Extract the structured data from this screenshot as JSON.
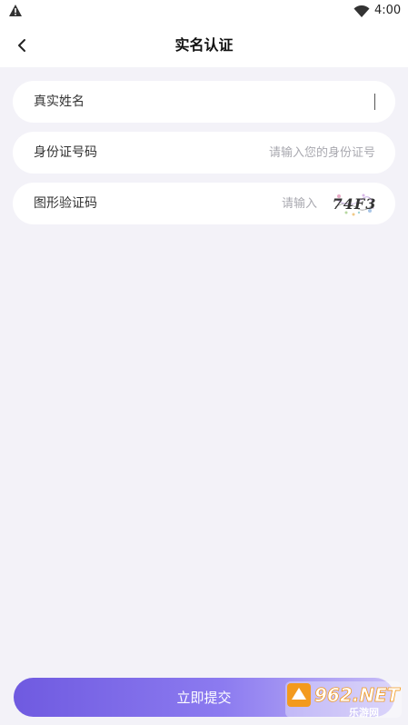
{
  "status": {
    "time": "4:00"
  },
  "header": {
    "title": "实名认证"
  },
  "form": {
    "name": {
      "label": "真实姓名",
      "value": "",
      "placeholder": ""
    },
    "id_number": {
      "label": "身份证号码",
      "value": "",
      "placeholder": "请输入您的身份证号"
    },
    "captcha": {
      "label": "图形验证码",
      "value": "",
      "placeholder": "请输入",
      "image_text": "74F3"
    }
  },
  "submit": {
    "label": "立即提交"
  },
  "watermark": {
    "brand": "962.NET",
    "sub": "乐游网"
  },
  "colors": {
    "accent_start": "#6f5ae0",
    "accent_end": "#c7bdf7",
    "background": "#f3f2f8"
  }
}
